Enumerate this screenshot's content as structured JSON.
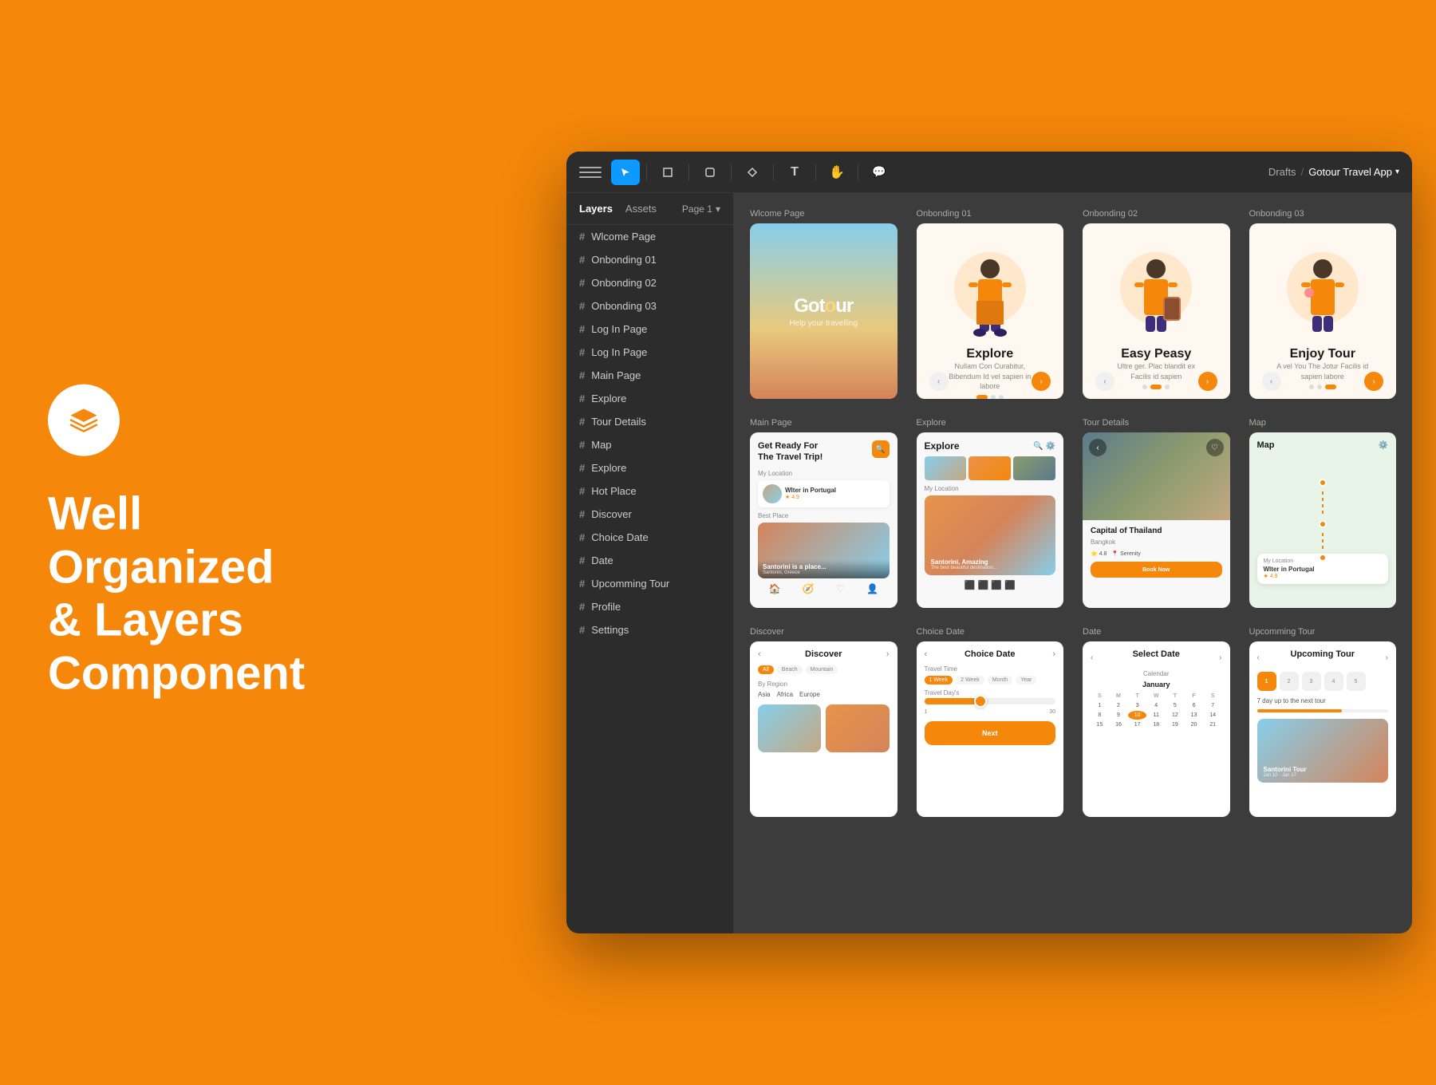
{
  "page": {
    "bg_color": "#F5870A"
  },
  "left": {
    "hero_line1": "Well Organized",
    "hero_line2": "& Layers",
    "hero_line3": "Component"
  },
  "toolbar": {
    "breadcrumb_drafts": "Drafts",
    "breadcrumb_project": "Gotour Travel App"
  },
  "sidebar": {
    "tab_layers": "Layers",
    "tab_assets": "Assets",
    "page_label": "Page 1",
    "items": [
      {
        "label": "Wlcome Page"
      },
      {
        "label": "Onbonding 01"
      },
      {
        "label": "Onbonding 02"
      },
      {
        "label": "Onbonding 03"
      },
      {
        "label": "Log In Page"
      },
      {
        "label": "Log In Page"
      },
      {
        "label": "Main Page"
      },
      {
        "label": "Explore"
      },
      {
        "label": "Tour Details"
      },
      {
        "label": "Map"
      },
      {
        "label": "Explore"
      },
      {
        "label": "Hot Place"
      },
      {
        "label": "Discover"
      },
      {
        "label": "Choice Date"
      },
      {
        "label": "Date"
      },
      {
        "label": "Upcomming Tour"
      },
      {
        "label": "Profile"
      },
      {
        "label": "Settings"
      }
    ]
  },
  "frames": {
    "row1": [
      {
        "label": "Wlcome Page"
      },
      {
        "label": "Onbonding 01"
      },
      {
        "label": "Onbonding 02"
      },
      {
        "label": "Onbonding 03"
      }
    ],
    "row2": [
      {
        "label": "Main Page"
      },
      {
        "label": "Explore"
      },
      {
        "label": "Tour Details"
      },
      {
        "label": "Map"
      }
    ],
    "row3": [
      {
        "label": "Discover"
      },
      {
        "label": "Choice Date"
      },
      {
        "label": "Date"
      },
      {
        "label": "Upcomming Tour"
      }
    ],
    "onboarding_titles": [
      "Explore",
      "Easy Peasy",
      "Enjoy Tour"
    ],
    "onboarding_subtitles": [
      "Nullam Con Curabitur, Bibendum\nId vel sapien in labore",
      "Ultre ger. Plac blandit ex\nFacilis id sapien",
      "A vel You The Jotur\nFacilis id sapien labore"
    ],
    "welcome_logo": "Gotour",
    "welcome_tagline": "Help your travelling",
    "main_header": "Get Ready For\nThe Travel Trip!",
    "main_location": "Wlter in Portugal",
    "main_best_place": "Santorini is a place...",
    "tour_title": "Capital of Thailand",
    "tour_sub": "Bangkok",
    "map_title": "Map",
    "discover_title": "Discover",
    "choice_date_title": "Choice Date",
    "date_title": "Select Date",
    "date_calendar_label": "January",
    "upcoming_title": "Upcoming Tour",
    "upcoming_days": "7 day up to the next tour"
  },
  "layers_icon": "⊕",
  "hash": "#"
}
